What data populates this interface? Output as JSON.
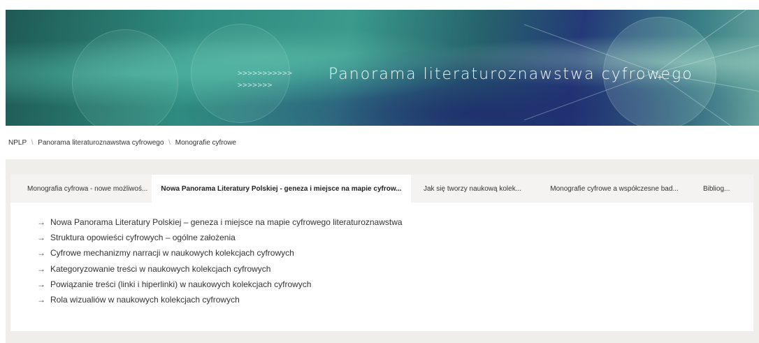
{
  "banner": {
    "arrows_line1": ">>>>>>>>>>>",
    "arrows_line2": ">>>>>>>",
    "title": "Panorama literaturoznawstwa cyfrowego",
    "plus": "+"
  },
  "breadcrumb": {
    "items": [
      "NPLP",
      "Panorama literaturoznawstwa cyfrowego",
      "Monografie cyfrowe"
    ],
    "separator": "\\"
  },
  "tabs": [
    {
      "label": "Monografia cyfrowa - nowe możliwoś...",
      "active": false
    },
    {
      "label": "Nowa Panorama Literatury Polskiej - geneza i miejsce na mapie cyfrow...",
      "active": true
    },
    {
      "label": "Jak się tworzy naukową kolek...",
      "active": false
    },
    {
      "label": "Monografie cyfrowe a współczesne bad...",
      "active": false
    },
    {
      "label": "Bibliog...",
      "active": false
    }
  ],
  "list": {
    "arrow": "→",
    "items": [
      "Nowa Panorama Literatury Polskiej – geneza i miejsce na mapie cyfrowego literaturoznawstwa",
      "Struktura opowieści cyfrowych – ogólne założenia",
      "Cyfrowe mechanizmy narracji w naukowych kolekcjach cyfrowych",
      "Kategoryzowanie treści w naukowych kolekcjach cyfrowych",
      "Powiązanie treści (linki i hiperlinki) w naukowych kolekcjach cyfrowych",
      "Rola wizualiów w naukowych kolekcjach cyfrowych"
    ]
  }
}
